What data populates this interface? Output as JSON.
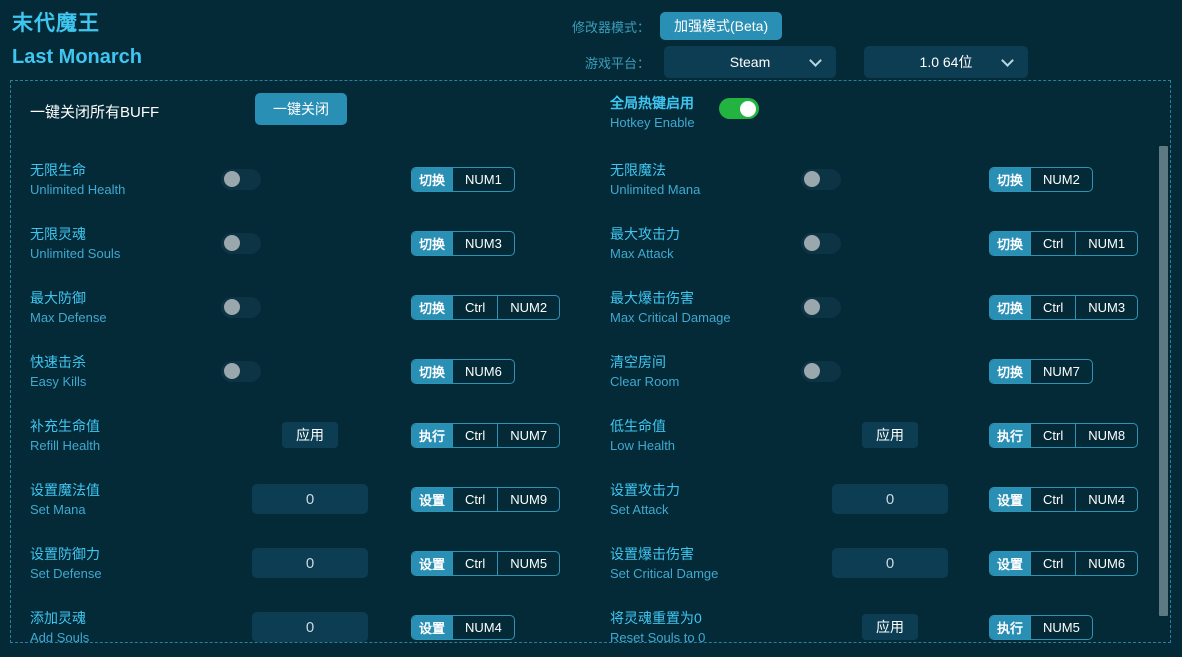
{
  "header": {
    "title_cn": "末代魔王",
    "title_en": "Last Monarch",
    "mode_label": "修改器模式：",
    "mode_value": "加强模式(Beta)",
    "platform_label": "游戏平台：",
    "platform_value": "Steam",
    "version_value": "1.0 64位",
    "caret_icon": "chevron-down-icon"
  },
  "toolbar": {
    "all_off_label": "一键关闭所有BUFF",
    "all_off_button": "一键关闭",
    "hotkey_cn": "全局热键启用",
    "hotkey_en": "Hotkey Enable",
    "hotkey_enabled": true
  },
  "colors": {
    "background": "#042a38",
    "accent": "#2a8fb5",
    "label_cn": "#3fc6f0",
    "label_en": "#3fa9d0",
    "field_bg": "#0d3d52",
    "toggle_on": "#22b341",
    "toggle_off": "#0c3445",
    "border_dashed": "#2a7f9e"
  },
  "rows": [
    {
      "cn": "无限生命",
      "en": "Unlimited Health",
      "control": "toggle",
      "toggle_on": false,
      "action": "切换",
      "keys": [
        "NUM1"
      ]
    },
    {
      "cn": "无限魔法",
      "en": "Unlimited Mana",
      "control": "toggle",
      "toggle_on": false,
      "action": "切换",
      "keys": [
        "NUM2"
      ]
    },
    {
      "cn": "无限灵魂",
      "en": "Unlimited Souls",
      "control": "toggle",
      "toggle_on": false,
      "action": "切换",
      "keys": [
        "NUM3"
      ]
    },
    {
      "cn": "最大攻击力",
      "en": "Max Attack",
      "control": "toggle",
      "toggle_on": false,
      "action": "切换",
      "keys": [
        "Ctrl",
        "NUM1"
      ]
    },
    {
      "cn": "最大防御",
      "en": "Max Defense",
      "control": "toggle",
      "toggle_on": false,
      "action": "切换",
      "keys": [
        "Ctrl",
        "NUM2"
      ]
    },
    {
      "cn": "最大爆击伤害",
      "en": "Max Critical Damage",
      "control": "toggle",
      "toggle_on": false,
      "action": "切换",
      "keys": [
        "Ctrl",
        "NUM3"
      ]
    },
    {
      "cn": "快速击杀",
      "en": "Easy Kills",
      "control": "toggle",
      "toggle_on": false,
      "action": "切换",
      "keys": [
        "NUM6"
      ]
    },
    {
      "cn": "清空房间",
      "en": "Clear Room",
      "control": "toggle",
      "toggle_on": false,
      "action": "切换",
      "keys": [
        "NUM7"
      ]
    },
    {
      "cn": "补充生命值",
      "en": "Refill Health",
      "control": "button",
      "button_label": "应用",
      "action": "执行",
      "keys": [
        "Ctrl",
        "NUM7"
      ]
    },
    {
      "cn": "低生命值",
      "en": "Low Health",
      "control": "button",
      "button_label": "应用",
      "action": "执行",
      "keys": [
        "Ctrl",
        "NUM8"
      ]
    },
    {
      "cn": "设置魔法值",
      "en": "Set Mana",
      "control": "input",
      "value": "0",
      "action": "设置",
      "keys": [
        "Ctrl",
        "NUM9"
      ]
    },
    {
      "cn": "设置攻击力",
      "en": "Set Attack",
      "control": "input",
      "value": "0",
      "action": "设置",
      "keys": [
        "Ctrl",
        "NUM4"
      ]
    },
    {
      "cn": "设置防御力",
      "en": "Set Defense",
      "control": "input",
      "value": "0",
      "action": "设置",
      "keys": [
        "Ctrl",
        "NUM5"
      ]
    },
    {
      "cn": "设置爆击伤害",
      "en": "Set Critical Damge",
      "control": "input",
      "value": "0",
      "action": "设置",
      "keys": [
        "Ctrl",
        "NUM6"
      ]
    },
    {
      "cn": "添加灵魂",
      "en": "Add Souls",
      "control": "input",
      "value": "0",
      "action": "设置",
      "keys": [
        "NUM4"
      ]
    },
    {
      "cn": "将灵魂重置为0",
      "en": "Reset Souls to 0",
      "control": "button",
      "button_label": "应用",
      "action": "执行",
      "keys": [
        "NUM5"
      ]
    }
  ]
}
